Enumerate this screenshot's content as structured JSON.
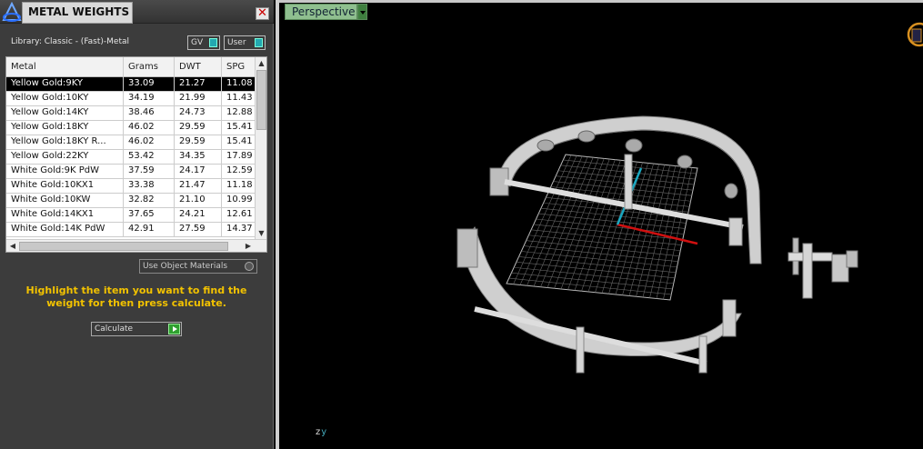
{
  "panel": {
    "title": "METAL WEIGHTS",
    "close_symbol": "✕",
    "library_label": "Library: Classic - (Fast)-Metal",
    "gv_label": "GV",
    "user_label": "User",
    "use_object_materials_label": "Use Object Materials",
    "instruction": "Highlight the item you want to find the weight for then press calculate.",
    "calculate_label": "Calculate"
  },
  "table": {
    "columns": [
      "Metal",
      "Grams",
      "DWT",
      "SPG"
    ],
    "rows": [
      {
        "metal": "Yellow Gold:9KY",
        "grams": "33.09",
        "dwt": "21.27",
        "spg": "11.08",
        "selected": true
      },
      {
        "metal": "Yellow Gold:10KY",
        "grams": "34.19",
        "dwt": "21.99",
        "spg": "11.43",
        "selected": false
      },
      {
        "metal": "Yellow Gold:14KY",
        "grams": "38.46",
        "dwt": "24.73",
        "spg": "12.88",
        "selected": false
      },
      {
        "metal": "Yellow Gold:18KY",
        "grams": "46.02",
        "dwt": "29.59",
        "spg": "15.41",
        "selected": false
      },
      {
        "metal": "Yellow Gold:18KY R...",
        "grams": "46.02",
        "dwt": "29.59",
        "spg": "15.41",
        "selected": false
      },
      {
        "metal": "Yellow Gold:22KY",
        "grams": "53.42",
        "dwt": "34.35",
        "spg": "17.89",
        "selected": false
      },
      {
        "metal": "White Gold:9K PdW",
        "grams": "37.59",
        "dwt": "24.17",
        "spg": "12.59",
        "selected": false
      },
      {
        "metal": "White Gold:10KX1",
        "grams": "33.38",
        "dwt": "21.47",
        "spg": "11.18",
        "selected": false
      },
      {
        "metal": "White Gold:10KW",
        "grams": "32.82",
        "dwt": "21.10",
        "spg": "10.99",
        "selected": false
      },
      {
        "metal": "White Gold:14KX1",
        "grams": "37.65",
        "dwt": "24.21",
        "spg": "12.61",
        "selected": false
      },
      {
        "metal": "White Gold:14K PdW",
        "grams": "42.91",
        "dwt": "27.59",
        "spg": "14.37",
        "selected": false
      }
    ]
  },
  "viewport": {
    "view_name": "Perspective",
    "axis_z": "z",
    "axis_y": "y"
  },
  "colors": {
    "instruction_text": "#f2c200",
    "selected_row": "#000000",
    "toggle_indicator": "#23a8b0",
    "perspective_tab": "#8fbf8f",
    "calculate_go": "#2fa02f"
  }
}
